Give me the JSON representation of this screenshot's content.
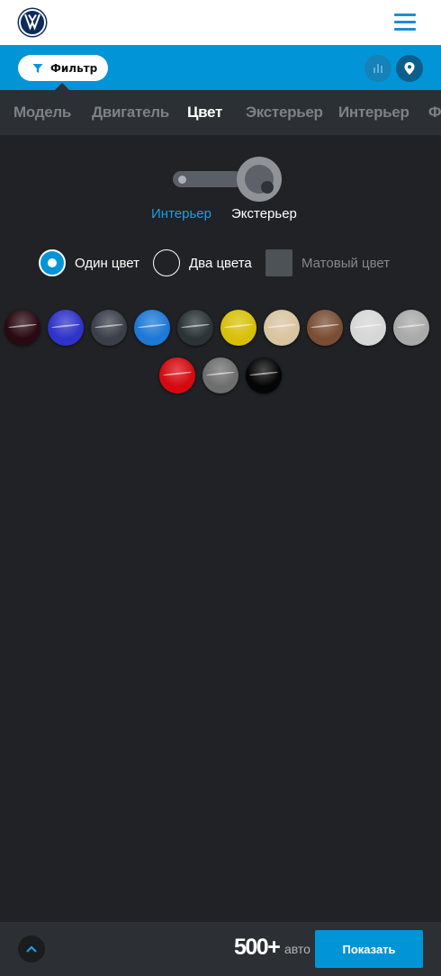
{
  "header": {
    "logo_icon": "volkswagen-logo",
    "menu_icon": "hamburger-menu-icon"
  },
  "filterbar": {
    "filter_label": "Фильтр",
    "filter_icon": "funnel-icon",
    "chart_icon": "bar-chart-icon",
    "map_icon": "map-pin-icon"
  },
  "tabs": [
    {
      "label": "Модель",
      "active": false
    },
    {
      "label": "Двигатель",
      "active": false
    },
    {
      "label": "Цвет",
      "active": true
    },
    {
      "label": "Экстерьер",
      "active": false
    },
    {
      "label": "Интерьер",
      "active": false
    },
    {
      "label": "Ф",
      "active": false
    }
  ],
  "color_toggle": {
    "left_label": "Интерьер",
    "right_label": "Экстерьер",
    "selected": "Экстерьер"
  },
  "color_options": [
    {
      "label": "Один цвет",
      "type": "radio",
      "checked": true
    },
    {
      "label": "Два цвета",
      "type": "radio",
      "checked": false
    },
    {
      "label": "Матовый цвет",
      "type": "checkbox",
      "checked": false
    }
  ],
  "swatches": [
    {
      "name": "black-cherry",
      "color": "#2a0a12"
    },
    {
      "name": "royal-blue",
      "color": "#2f33c8"
    },
    {
      "name": "dark-graphite",
      "color": "#3b3f4a"
    },
    {
      "name": "sky-blue",
      "color": "#1d78d6"
    },
    {
      "name": "dark-green-grey",
      "color": "#2a3436"
    },
    {
      "name": "yellow",
      "color": "#d8c00a"
    },
    {
      "name": "beige",
      "color": "#d8c4a0"
    },
    {
      "name": "brown",
      "color": "#7a4e34"
    },
    {
      "name": "white-silver",
      "color": "#d6d6d6"
    },
    {
      "name": "silver",
      "color": "#a9a9a9"
    },
    {
      "name": "red",
      "color": "#d40a10"
    },
    {
      "name": "grey",
      "color": "#6e6e6e"
    },
    {
      "name": "black",
      "color": "#050505"
    }
  ],
  "bottombar": {
    "up_icon": "chevron-up-icon",
    "count": "500+",
    "count_unit": "авто",
    "show_label": "Показать"
  },
  "colors": {
    "accent": "#0195d8",
    "background": "#202225",
    "panel": "#2c3034"
  }
}
